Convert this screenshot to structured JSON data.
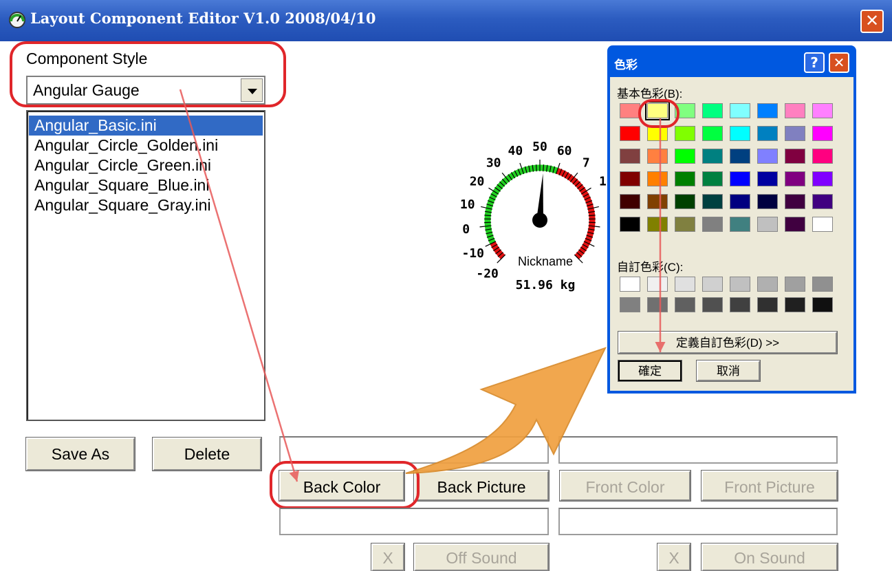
{
  "window": {
    "title": "Layout Component Editor V1.0  2008/04/10",
    "close_glyph": "✕"
  },
  "component_style": {
    "label": "Component Style",
    "selected": "Angular Gauge"
  },
  "files": [
    "Angular_Basic.ini",
    "Angular_Circle_Golden.ini",
    "Angular_Circle_Green.ini",
    "Angular_Square_Blue.ini",
    "Angular_Square_Gray.ini"
  ],
  "selected_file_index": 0,
  "buttons": {
    "save_as": "Save As",
    "delete": "Delete",
    "back_color": "Back Color",
    "back_picture": "Back Picture",
    "front_color": "Front Color",
    "front_picture": "Front Picture",
    "off_x": "X",
    "off_sound": "Off Sound",
    "on_x": "X",
    "on_sound": "On Sound"
  },
  "gauge": {
    "ticks": [
      "-20",
      "-10",
      "0",
      "10",
      "20",
      "30",
      "40",
      "50",
      "60",
      "7",
      "1"
    ],
    "name": "Nickname",
    "reading": "51.96 kg",
    "value": 51.96
  },
  "color_dialog": {
    "title": "色彩",
    "help_glyph": "?",
    "close_glyph": "✕",
    "basic_label": "基本色彩(B):",
    "custom_label": "自訂色彩(C):",
    "define_button": "定義自訂色彩(D) >>",
    "ok": "確定",
    "cancel": "取消",
    "basic_colors": [
      [
        "#ff8080",
        "#ffff80",
        "#80ff80",
        "#00ff80",
        "#80ffff",
        "#0080ff",
        "#ff80c0",
        "#ff80ff"
      ],
      [
        "#ff0000",
        "#ffff00",
        "#80ff00",
        "#00ff40",
        "#00ffff",
        "#0080c0",
        "#8080c0",
        "#ff00ff"
      ],
      [
        "#804040",
        "#ff8040",
        "#00ff00",
        "#008080",
        "#004080",
        "#8080ff",
        "#800040",
        "#ff0080"
      ],
      [
        "#800000",
        "#ff8000",
        "#008000",
        "#008040",
        "#0000ff",
        "#0000a0",
        "#800080",
        "#8000ff"
      ],
      [
        "#400000",
        "#804000",
        "#004000",
        "#004040",
        "#000080",
        "#000040",
        "#400040",
        "#400080"
      ],
      [
        "#000000",
        "#808000",
        "#808040",
        "#808080",
        "#408080",
        "#c0c0c0",
        "#400040",
        "#ffffff"
      ]
    ],
    "custom_colors": [
      [
        "#ffffff",
        "#f0f0f0",
        "#e0e0e0",
        "#d0d0d0",
        "#c0c0c0",
        "#b0b0b0",
        "#a0a0a0",
        "#909090"
      ],
      [
        "#808080",
        "#707070",
        "#606060",
        "#505050",
        "#404040",
        "#303030",
        "#202020",
        "#101010"
      ]
    ],
    "selected_swatch": [
      0,
      1
    ]
  }
}
